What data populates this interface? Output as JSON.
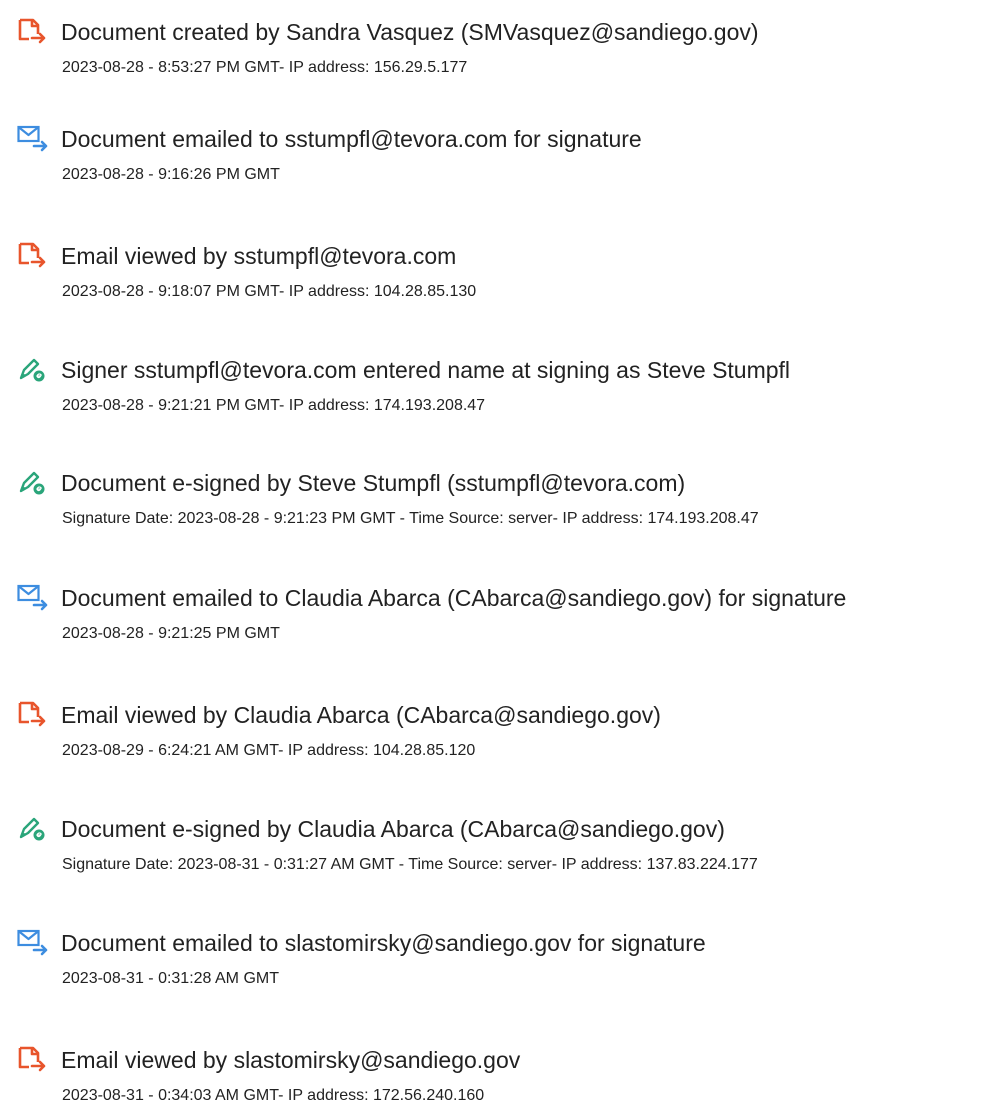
{
  "events": [
    {
      "icon": "document-created-icon",
      "title": "Document created by Sandra Vasquez (SMVasquez@sandiego.gov)",
      "detail": "2023-08-28 - 8:53:27 PM GMT- IP address: 156.29.5.177"
    },
    {
      "icon": "email-sent-icon",
      "title": "Document emailed to sstumpfl@tevora.com for signature",
      "detail": "2023-08-28 - 9:16:26 PM GMT"
    },
    {
      "icon": "document-viewed-icon",
      "title": "Email viewed by sstumpfl@tevora.com",
      "detail": "2023-08-28 - 9:18:07 PM GMT- IP address: 104.28.85.130"
    },
    {
      "icon": "esign-pen-icon",
      "title": "Signer sstumpfl@tevora.com entered name at signing as Steve Stumpfl",
      "detail": "2023-08-28 - 9:21:21 PM GMT- IP address: 174.193.208.47"
    },
    {
      "icon": "esign-pen-icon",
      "title": "Document e-signed by Steve Stumpfl (sstumpfl@tevora.com)",
      "detail": "Signature Date: 2023-08-28 - 9:21:23 PM GMT - Time Source: server- IP address: 174.193.208.47"
    },
    {
      "icon": "email-sent-icon",
      "title": "Document emailed to Claudia Abarca (CAbarca@sandiego.gov) for signature",
      "detail": "2023-08-28 - 9:21:25 PM GMT"
    },
    {
      "icon": "document-viewed-icon",
      "title": "Email viewed by Claudia Abarca (CAbarca@sandiego.gov)",
      "detail": "2023-08-29 - 6:24:21 AM GMT- IP address: 104.28.85.120"
    },
    {
      "icon": "esign-pen-icon",
      "title": "Document e-signed by Claudia Abarca (CAbarca@sandiego.gov)",
      "detail": "Signature Date: 2023-08-31 - 0:31:27 AM GMT - Time Source: server- IP address: 137.83.224.177"
    },
    {
      "icon": "email-sent-icon",
      "title": "Document emailed to slastomirsky@sandiego.gov for signature",
      "detail": "2023-08-31 - 0:31:28 AM GMT"
    },
    {
      "icon": "document-viewed-icon",
      "title": "Email viewed by slastomirsky@sandiego.gov",
      "detail": "2023-08-31 - 0:34:03 AM GMT- IP address: 172.56.240.160"
    }
  ],
  "colors": {
    "document_icon_orange": "#e8552c",
    "email_icon_blue": "#3d8de0",
    "pen_icon_green": "#2aa57a",
    "text": "#222222"
  }
}
